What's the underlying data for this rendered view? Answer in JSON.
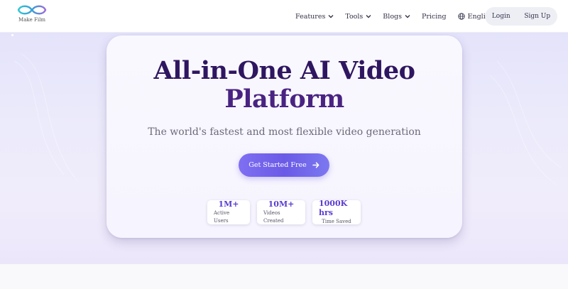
{
  "brand": {
    "name": "Make Film"
  },
  "nav": {
    "items": [
      {
        "label": "Features",
        "has_dropdown": true
      },
      {
        "label": "Tools",
        "has_dropdown": true
      },
      {
        "label": "Blogs",
        "has_dropdown": true
      },
      {
        "label": "Pricing",
        "has_dropdown": false
      }
    ],
    "language": "English"
  },
  "auth": {
    "login": "Login",
    "signup": "Sign Up"
  },
  "hero": {
    "title_line1": "All-in-One AI Video",
    "title_line2": "Platform",
    "subtitle": "The world's fastest and most flexible video generation",
    "cta_label": "Get Started Free",
    "cta_icon": "arrow-right-icon",
    "stats": [
      {
        "value": "1M+",
        "label": "Active Users"
      },
      {
        "value": "10M+",
        "label": "Videos Created"
      },
      {
        "value": "1000K hrs",
        "label": "Time Saved"
      }
    ]
  },
  "colors": {
    "accent": "#6a5ae6",
    "title": "#3b1b6b",
    "stat_value": "#5a3bd0",
    "hero_bg": "#e8e6fb"
  }
}
